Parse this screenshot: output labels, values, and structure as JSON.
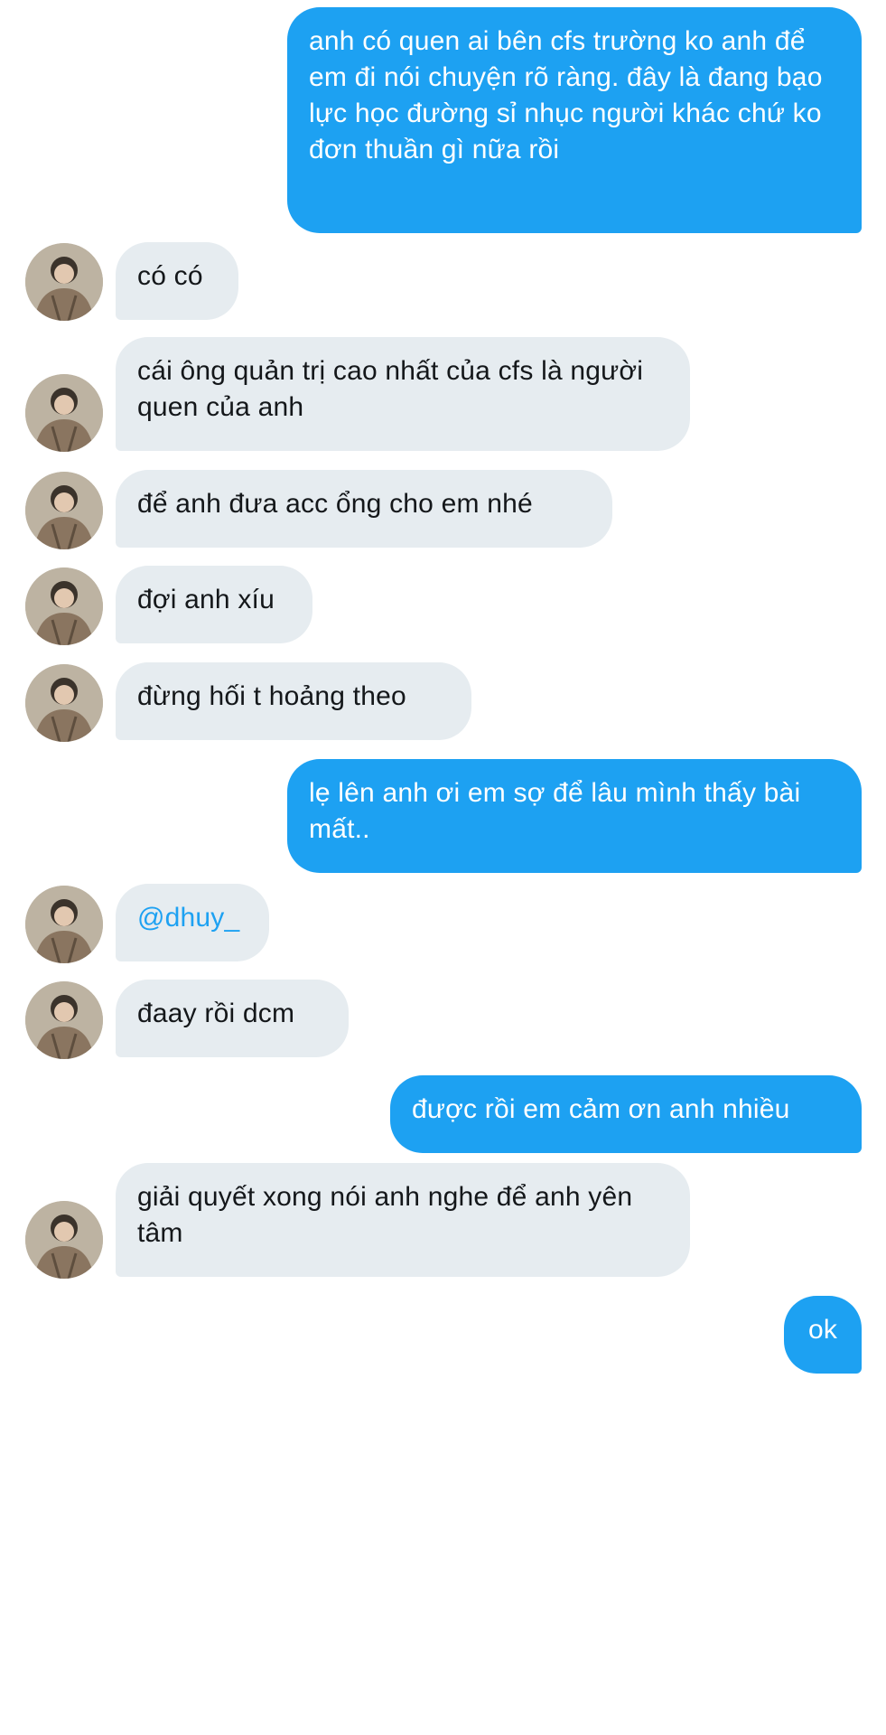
{
  "conversation": {
    "messages": [
      {
        "direction": "sent",
        "text": "anh có quen ai bên cfs trường ko anh để em đi nói chuyện rõ ràng. đây là đang bạo lực học đường sỉ nhục người khác chứ ko đơn thuần gì nữa rồi"
      },
      {
        "direction": "received",
        "text": "có có"
      },
      {
        "direction": "received",
        "text": "cái ông quản trị cao nhất của cfs là người quen của anh"
      },
      {
        "direction": "received",
        "text": "để anh đưa acc ổng cho em nhé"
      },
      {
        "direction": "received",
        "text": "đợi anh xíu"
      },
      {
        "direction": "received",
        "text": "đừng hối t hoảng theo"
      },
      {
        "direction": "sent",
        "text": "lẹ lên anh ơi em sợ để lâu mình thấy bài mất.."
      },
      {
        "direction": "received",
        "text": "@dhuy_",
        "style": "mention"
      },
      {
        "direction": "received",
        "text": "đaay rồi dcm"
      },
      {
        "direction": "sent",
        "text": "được rồi em cảm ơn anh nhiều"
      },
      {
        "direction": "received",
        "text": "giải quyết xong nói anh nghe để anh yên tâm"
      },
      {
        "direction": "sent",
        "text": "ok"
      }
    ]
  },
  "colors": {
    "sent_bubble": "#1da1f2",
    "received_bubble": "#e6ecf0",
    "mention": "#1da1f2",
    "text_dark": "#14171a"
  },
  "icons": {
    "avatar": "contact-avatar-photo"
  }
}
